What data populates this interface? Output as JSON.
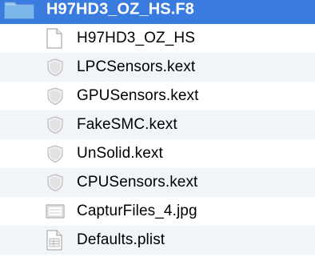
{
  "folder": {
    "name": "H97HD3_OZ_HS.F8",
    "accent": "#3a7be0",
    "icon": "folder-icon"
  },
  "items": [
    {
      "name": "H97HD3_OZ_HS",
      "icon": "blank-document-icon"
    },
    {
      "name": "LPCSensors.kext",
      "icon": "kext-shield-icon"
    },
    {
      "name": "GPUSensors.kext",
      "icon": "kext-shield-icon"
    },
    {
      "name": "FakeSMC.kext",
      "icon": "kext-shield-icon"
    },
    {
      "name": "UnSolid.kext",
      "icon": "kext-shield-icon"
    },
    {
      "name": "CPUSensors.kext",
      "icon": "kext-shield-icon"
    },
    {
      "name": "CapturFiles_4.jpg",
      "icon": "image-file-icon"
    },
    {
      "name": "Defaults.plist",
      "icon": "plist-file-icon"
    }
  ]
}
